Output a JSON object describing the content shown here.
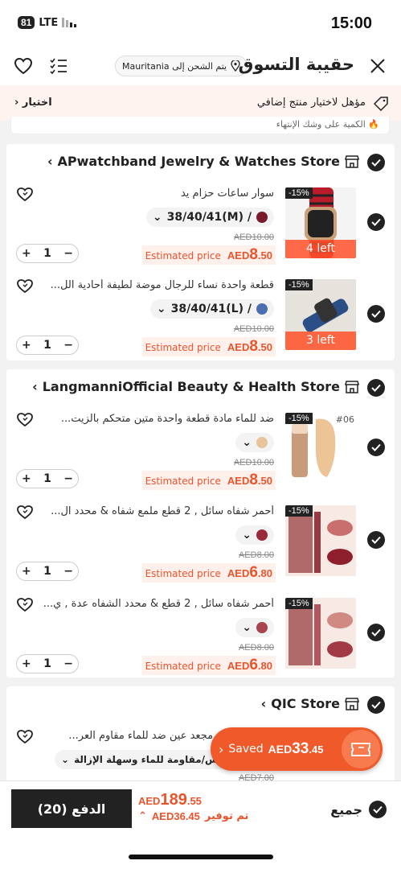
{
  "status": {
    "time": "15:00",
    "battery": "81",
    "network": "LTE"
  },
  "header": {
    "title": "حقيبة التسوق",
    "ship_to": "يتم الشحن إلى Mauritania"
  },
  "promo": {
    "text": "مؤهل لاختيار منتج إضافي",
    "select_label": "اختيار"
  },
  "tip": {
    "text": "الكمية على وشك الإنتهاء"
  },
  "stores": [
    {
      "name": "APwatchband Jewelry & Watches Store",
      "items": [
        {
          "title": "سوار ساعات حزام يد",
          "variant": "38/40/41(M) /",
          "variant_color": "#7a1a2a",
          "discount": "-15%",
          "stock": "4 left",
          "old_price": "AED10.00",
          "est_label": "Estimated price",
          "currency": "AED",
          "price_int": "8",
          "price_dec": ".50",
          "qty": "1"
        },
        {
          "title": "قطعة واحدة نساء للرجال موضة لطيفة أحادية الل...",
          "variant": "38/40/41(L) /",
          "variant_color": "#4a6fb0",
          "discount": "-15%",
          "stock": "3 left",
          "old_price": "AED10.00",
          "est_label": "Estimated price",
          "currency": "AED",
          "price_int": "8",
          "price_dec": ".50",
          "qty": "1"
        }
      ]
    },
    {
      "name": "LangmanniOfficial Beauty & Health Store",
      "items": [
        {
          "title": "ضد للماء مادة قطعة واحدة متين متحكم بالزيت...",
          "variant_color": "#e8c49a",
          "discount": "-15%",
          "thumb_tag": "#06",
          "old_price": "AED10.00",
          "est_label": "Estimated price",
          "currency": "AED",
          "price_int": "8",
          "price_dec": ".50",
          "qty": "1"
        },
        {
          "title": "أحمر شفاه سائل , 2 قطع ملمع شفاه & محدد ال...",
          "variant_color": "#9a2a3a",
          "discount": "-15%",
          "old_price": "AED8.00",
          "est_label": "Estimated price",
          "currency": "AED",
          "price_int": "6",
          "price_dec": ".80",
          "qty": "1"
        },
        {
          "title": "أحمر شفاه سائل , 2 قطع & محدد الشفاه عدة , ي...",
          "variant_color": "#a84450",
          "discount": "-15%",
          "old_price": "AED8.00",
          "est_label": "Estimated price",
          "currency": "AED",
          "price_int": "6",
          "price_dec": ".80",
          "qty": "1"
        }
      ]
    },
    {
      "name": "QIC Store",
      "items": [
        {
          "title": "... و مجعد عين ضد للماء مقاوم العر...",
          "variant": "يس/مقاومة للماء وسهلة الإزالة",
          "old_price": "AED7.00"
        }
      ]
    }
  ],
  "saved": {
    "label": "Saved",
    "currency": "AED",
    "amount_int": "33",
    "amount_dec": ".45"
  },
  "footer": {
    "all_label": "جميع",
    "total_currency": "AED",
    "total_int": "189",
    "total_dec": ".55",
    "savings_label": "تم توفير",
    "savings_value": "AED36.45",
    "pay_label": "الدفع (20)"
  }
}
